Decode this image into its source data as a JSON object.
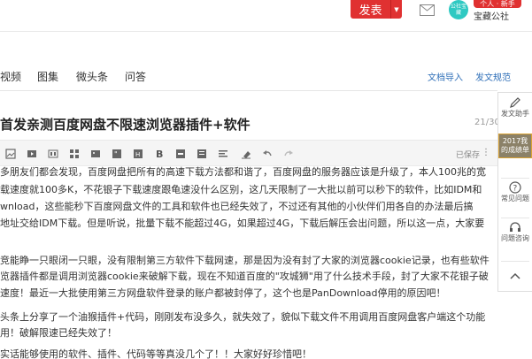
{
  "header": {
    "publish_label": "发表",
    "badge": "个人 · 新手",
    "username": "宝藏公社",
    "avatar_text": "公社宝藏"
  },
  "nav": {
    "tabs": [
      {
        "label": "视频"
      },
      {
        "label": "图集"
      },
      {
        "label": "微头条"
      },
      {
        "label": "问答"
      }
    ],
    "import_label": "文档导入",
    "history_label": "发文规范"
  },
  "article": {
    "title": "首发亲测百度网盘不限速浏览器插件+软件",
    "title_counter": "21/30",
    "saved_status": "已保存",
    "more": "⋮",
    "lines": [
      "多朋友们都会发现，百度网盘把所有的高速下载方法都和谐了，百度网盘的服务器应该是升级了，本人100兆的宽",
      "载速度就100多K，不花银子下载速度跟龟速没什么区别，这几天限制了一大批以前可以秒下的软件，比如IDM和",
      "wnload，这些能秒下百度网盘文件的工具和软件也已经失效了，不过还有其他的小伙伴们用各自的办法最后搞",
      "地址交给IDM下载。但是听说，批量下载不能超过4G，如果超过4G，下载后解压会出问题，所以这一点，大家要",
      "",
      "竞能睁一只眼闭一只眼，没有限制第三方软件下载网速，那是因为没有封了大家的浏览器cookie记录，也有些软件",
      "览器插件都是调用浏览器cookie来破解下载，现在不知道百度的\"攻城狮\"用了什么技术手段，封了大家不花银子破",
      "速度！最近一大批使用第三方网盘软件登录的账户都被封停了，这个也是PanDownload停用的原因吧！",
      "",
      "头条上分享了一个油猴插件+代码，刚刚发布没多久，就失效了，貌似下载文件不用调用百度网盘客户端这个功能",
      "用！破解限速已经失效了！",
      "",
      "实话能够使用的软件、插件、代码等等真没几个了！！大家好好珍惜吧！"
    ]
  },
  "sidebar": {
    "items": [
      {
        "label": "发文助手",
        "icon": "pen-icon"
      },
      {
        "label": "2017我的成绩单"
      },
      {
        "label": "常见问题",
        "icon": "question-icon"
      },
      {
        "label": "问题咨询",
        "icon": "headset-icon"
      }
    ]
  },
  "colors": {
    "accent": "#e03131",
    "link": "#2f6fb8",
    "promo": "#8b8168"
  }
}
